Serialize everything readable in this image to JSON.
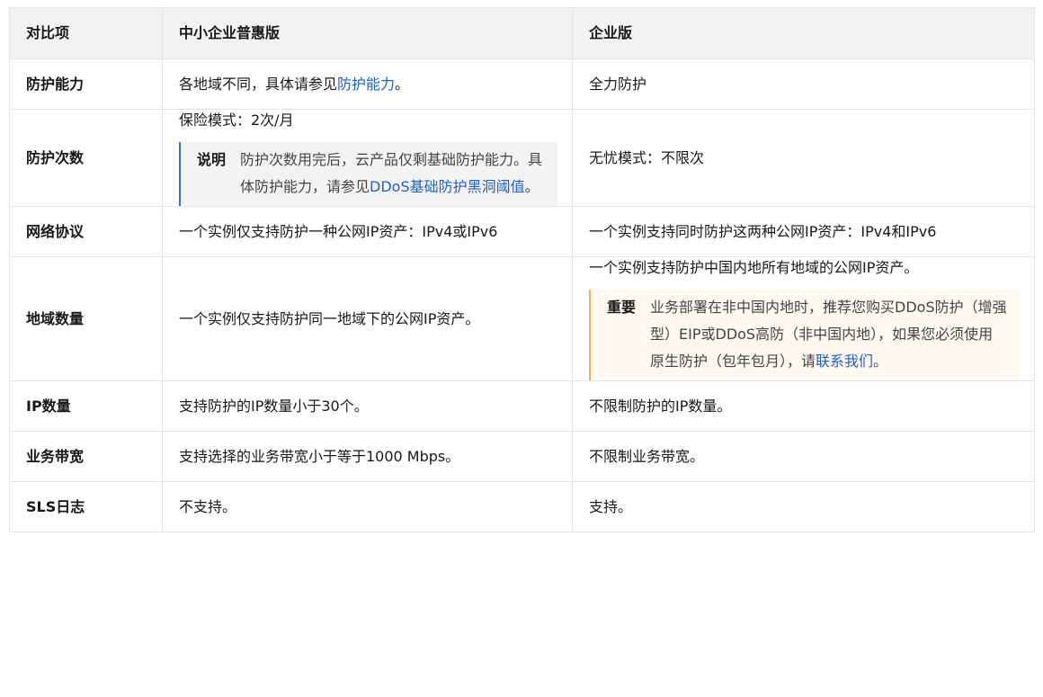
{
  "header": {
    "col1": "对比项",
    "col2": "中小企业普惠版",
    "col3": "企业版"
  },
  "rows": [
    {
      "label": "防护能力",
      "std_prefix": "各地域不同，具体请参见",
      "std_link": "防护能力",
      "std_suffix": "。",
      "ent": "全力防护"
    },
    {
      "label": "防护次数",
      "std_text": "保险模式：2次/月",
      "std_note_label": "说明",
      "std_note_text": "防护次数用完后，云产品仅剩基础防护能力。具体防护能力，请参见",
      "std_note_link": "DDoS基础防护黑洞阈值",
      "std_note_suffix": "。",
      "ent": "无忧模式：不限次"
    },
    {
      "label": "网络协议",
      "std": "一个实例仅支持防护一种公网IP资产：IPv4或IPv6",
      "ent": "一个实例支持同时防护这两种公网IP资产：IPv4和IPv6"
    },
    {
      "label": "地域数量",
      "std": "一个实例仅支持防护同一地域下的公网IP资产。",
      "ent_text": "一个实例支持防护中国内地所有地域的公网IP资产。",
      "ent_note_label": "重要",
      "ent_note_text": "业务部署在非中国内地时，推荐您购买DDoS防护（增强型）EIP或DDoS高防（非中国内地），如果您必须使用原生防护（包年包月），请",
      "ent_note_link": "联系我们",
      "ent_note_suffix": "。"
    },
    {
      "label": "IP数量",
      "std": "支持防护的IP数量小于30个。",
      "ent": "不限制防护的IP数量。"
    },
    {
      "label": "业务带宽",
      "std": "支持选择的业务带宽小于等于1000 Mbps。",
      "ent": "不限制业务带宽。"
    },
    {
      "label": "SLS日志",
      "std": "不支持。",
      "ent": "支持。"
    }
  ],
  "colors": {
    "link": "#1f5fd4",
    "note_border": "#3b6fd9",
    "important_border": "#f1b055",
    "header_bg": "#f2f2f2"
  }
}
